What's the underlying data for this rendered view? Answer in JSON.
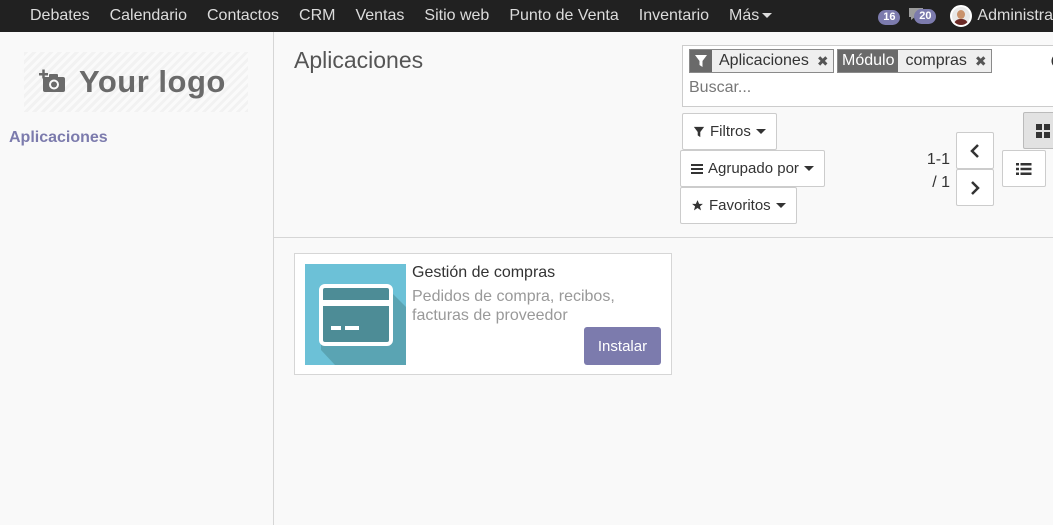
{
  "topbar": {
    "menu": [
      "Debates",
      "Calendario",
      "Contactos",
      "CRM",
      "Ventas",
      "Sitio web",
      "Punto de Venta",
      "Inventario",
      "Más"
    ],
    "notifications_count": "16",
    "messages_count": "20",
    "user_name": "Administra"
  },
  "sidebar": {
    "logo_text": "Your logo",
    "items": [
      {
        "label": "Aplicaciones"
      }
    ]
  },
  "control_panel": {
    "title": "Aplicaciones",
    "search": {
      "facets": [
        {
          "label_icon": "filter-icon",
          "value": "Aplicaciones"
        },
        {
          "label": "Módulo",
          "value": "compras"
        }
      ],
      "placeholder": "Buscar..."
    },
    "filters_label": "Filtros",
    "groupby_label": "Agrupado por",
    "favorites_label": "Favoritos",
    "pager": {
      "range": "1-1",
      "total": "/ 1"
    }
  },
  "apps": [
    {
      "name": "Gestión de compras",
      "summary": "Pedidos de compra, recibos, facturas de proveedor",
      "action_label": "Instalar",
      "icon_colors": {
        "bg": "#6cc1d7",
        "shadow": "#4d8c96",
        "card": "#ffffff"
      }
    }
  ],
  "colors": {
    "accent": "#7c7bad",
    "topbar": "#212121"
  }
}
